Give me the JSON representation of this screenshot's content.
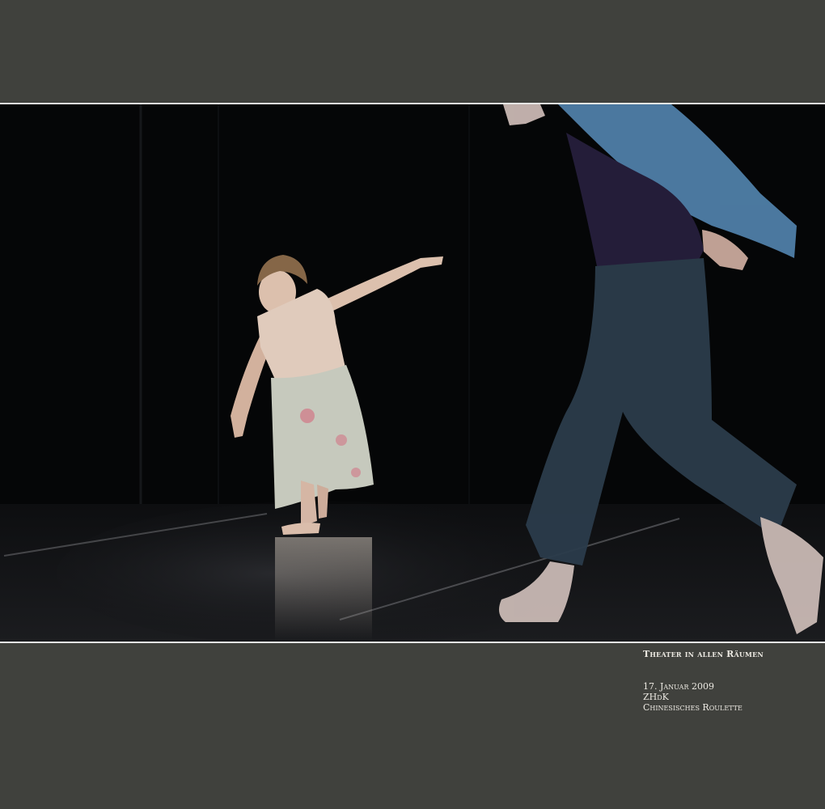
{
  "photo": {
    "subject": "dance performance",
    "colors": {
      "page_background": "#40413d",
      "stage_background": "#050607",
      "border": "#e6e6e4"
    }
  },
  "caption": {
    "title": "Theater in allen Räumen",
    "lines": [
      "17. Januar 2009",
      "ZHdK",
      "Chinesisches Roulette"
    ]
  }
}
